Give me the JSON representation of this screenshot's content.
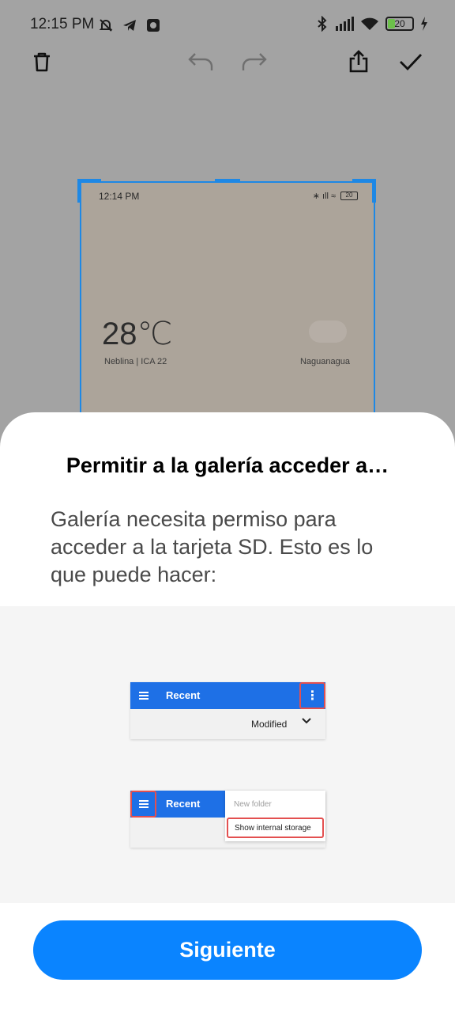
{
  "status_bar": {
    "time": "12:15 PM",
    "battery": "20"
  },
  "toolbar": {
    "icons": [
      "delete-icon",
      "undo-icon",
      "redo-icon",
      "share-icon",
      "done-icon"
    ]
  },
  "preview": {
    "time": "12:14 PM",
    "battery": "20",
    "temperature": "28℃",
    "condition": "Neblina | ICA 22",
    "city": "Naguanagua"
  },
  "sheet": {
    "title": "Permitir a la galería acceder a…",
    "description": "Galería necesita permiso para acceder a la tarjeta SD. Esto es lo que puede hacer:",
    "demo1": {
      "title": "Recent",
      "sort_label": "Modified",
      "kebab": "⋮"
    },
    "demo2": {
      "title": "Recent",
      "menu_item_1": "New folder",
      "menu_item_2": "Show internal storage"
    },
    "next_button": "Siguiente"
  },
  "colors": {
    "accent": "#0a84ff",
    "mock_bar": "#1e70e6",
    "highlight": "#e35050"
  }
}
